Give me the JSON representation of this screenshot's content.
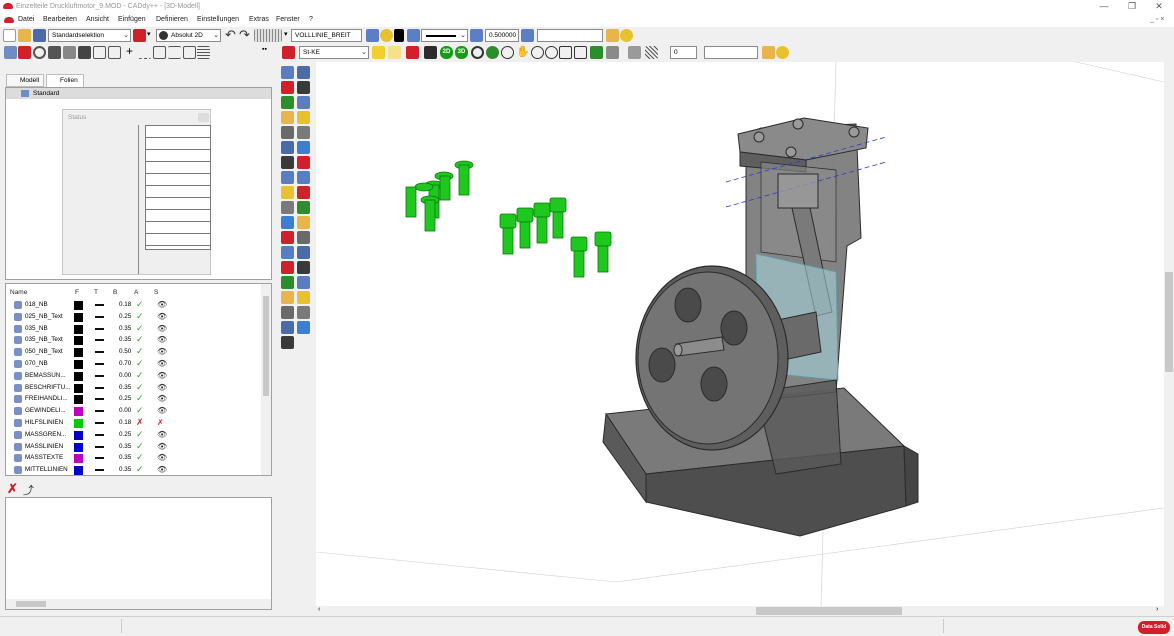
{
  "window": {
    "title": "Einzelteile Druckluftmotor_9.MOD  -  CADdy++ - [3D-Modell]",
    "minimize_glyph": "—",
    "restore_glyph": "❐",
    "close_glyph": "✕",
    "child_controls": "_ ▫ ×"
  },
  "menu": [
    "Datei",
    "Bearbeiten",
    "Ansicht",
    "Einfügen",
    "Definieren",
    "Einstellungen",
    "Extras",
    "Fenster",
    "?"
  ],
  "toolbar1": {
    "selection_mode": "Standardselektion",
    "coordinate_mode": "Absolut 2D",
    "line_type": "VOLLLINIE_BREIT",
    "line_width": "0.500000",
    "input_value": ""
  },
  "toolbar2": {
    "layer_combo": "St-KE",
    "view2d_label": "2D",
    "view3d_label": "3D",
    "spin_value": "0"
  },
  "left_tabs": {
    "model": "Modell",
    "layers": "Folien"
  },
  "tree": {
    "root": "Standard"
  },
  "status_panel": {
    "title": "Status"
  },
  "layer_table": {
    "headers": [
      "Name",
      "F",
      "T",
      "B",
      "A",
      "S"
    ],
    "rows": [
      {
        "name": "018_NB",
        "color": "#000000",
        "width": "0.18",
        "active": "✓",
        "visible": "👁"
      },
      {
        "name": "025_NB_Text",
        "color": "#000000",
        "width": "0.25",
        "active": "✓",
        "visible": "👁"
      },
      {
        "name": "035_NB",
        "color": "#000000",
        "width": "0.35",
        "active": "✓",
        "visible": "👁"
      },
      {
        "name": "035_NB_Text",
        "color": "#000000",
        "width": "0.35",
        "active": "✓",
        "visible": "👁"
      },
      {
        "name": "050_NB_Text",
        "color": "#000000",
        "width": "0.50",
        "active": "✓",
        "visible": "👁"
      },
      {
        "name": "070_NB",
        "color": "#000000",
        "width": "0.70",
        "active": "✓",
        "visible": "👁"
      },
      {
        "name": "BEMASSUN...",
        "color": "#000000",
        "width": "0.00",
        "active": "✓",
        "visible": "👁"
      },
      {
        "name": "BESCHRIFTU...",
        "color": "#000000",
        "width": "0.35",
        "active": "✓",
        "visible": "👁"
      },
      {
        "name": "FREIHANDLI...",
        "color": "#000000",
        "width": "0.25",
        "active": "✓",
        "visible": "👁"
      },
      {
        "name": "GEWINDELI...",
        "color": "#c000c0",
        "width": "0.00",
        "active": "✓",
        "visible": "👁"
      },
      {
        "name": "HILFSLINIEN",
        "color": "#00cc00",
        "width": "0.18",
        "active": "✗",
        "visible": "✗"
      },
      {
        "name": "MASSGREN...",
        "color": "#0000cc",
        "width": "0.25",
        "active": "✓",
        "visible": "👁"
      },
      {
        "name": "MASSLINIEN",
        "color": "#0000cc",
        "width": "0.35",
        "active": "✓",
        "visible": "👁"
      },
      {
        "name": "MASSTEXTE",
        "color": "#c000c0",
        "width": "0.35",
        "active": "✓",
        "visible": "👁"
      },
      {
        "name": "MITTELLINIEN",
        "color": "#0000cc",
        "width": "0.35",
        "active": "✓",
        "visible": "👁"
      }
    ]
  },
  "brand": "Data Solid",
  "colors": {
    "accent_red": "#d0202a",
    "screw_green": "#1ec81e",
    "part_gray": "#6e6e6e",
    "glass_blue": "#a9dbe2"
  }
}
